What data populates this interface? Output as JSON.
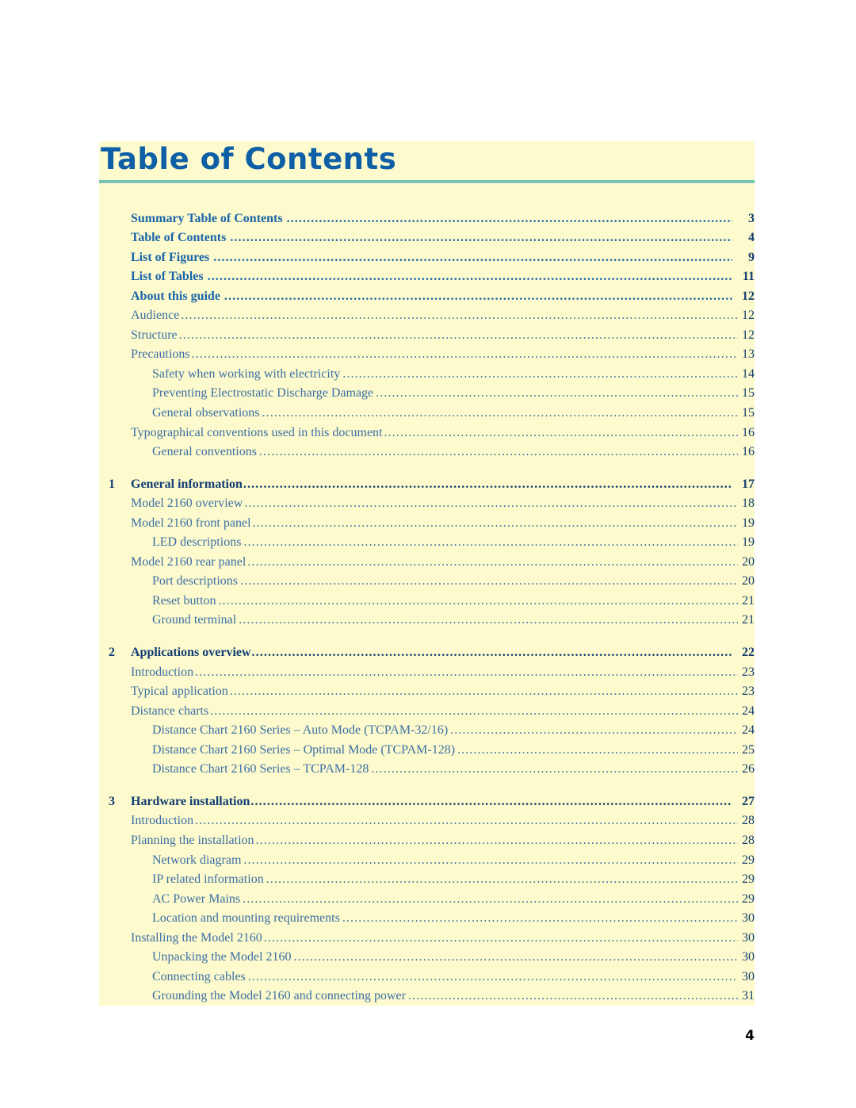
{
  "document": {
    "title": "Table of Contents",
    "footer_page_number": "4",
    "accent_rule_color": "#76c3b4",
    "panel_color": "#fdfbcd",
    "title_color": "#0f5fa6"
  },
  "toc": {
    "entries": [
      {
        "level": "lvl0",
        "number": "",
        "label": "Summary Table of Contents",
        "page": "3"
      },
      {
        "level": "lvl0",
        "number": "",
        "label": "Table of Contents",
        "page": "4"
      },
      {
        "level": "lvl0",
        "number": "",
        "label": "List of Figures",
        "page": "9"
      },
      {
        "level": "lvl0",
        "number": "",
        "label": "List of Tables",
        "page": "11"
      },
      {
        "level": "lvl0",
        "number": "",
        "label": "About this guide",
        "page": "12"
      },
      {
        "level": "lvl1",
        "number": "",
        "label": "Audience",
        "page": "12"
      },
      {
        "level": "lvl1",
        "number": "",
        "label": "Structure",
        "page": "12"
      },
      {
        "level": "lvl1",
        "number": "",
        "label": "Precautions",
        "page": "13"
      },
      {
        "level": "lvl2",
        "number": "",
        "label": "Safety when working with electricity",
        "page": "14"
      },
      {
        "level": "lvl2",
        "number": "",
        "label": "Preventing Electrostatic Discharge Damage",
        "page": "15"
      },
      {
        "level": "lvl2",
        "number": "",
        "label": "General observations",
        "page": "15"
      },
      {
        "level": "lvl1",
        "number": "",
        "label": "Typographical conventions used in this document",
        "page": "16"
      },
      {
        "level": "lvl2",
        "number": "",
        "label": "General conventions",
        "page": "16"
      },
      {
        "level": "chap",
        "number": "1",
        "label": "General information",
        "page": "17",
        "gap": true
      },
      {
        "level": "lvl1",
        "number": "",
        "label": "Model 2160 overview",
        "page": "18"
      },
      {
        "level": "lvl1",
        "number": "",
        "label": "Model 2160 front panel",
        "page": "19"
      },
      {
        "level": "lvl2",
        "number": "",
        "label": "LED descriptions",
        "page": "19"
      },
      {
        "level": "lvl1",
        "number": "",
        "label": "Model 2160 rear panel",
        "page": "20"
      },
      {
        "level": "lvl2",
        "number": "",
        "label": "Port descriptions",
        "page": "20"
      },
      {
        "level": "lvl2",
        "number": "",
        "label": "Reset button",
        "page": "21"
      },
      {
        "level": "lvl2",
        "number": "",
        "label": "Ground terminal",
        "page": "21"
      },
      {
        "level": "chap",
        "number": "2",
        "label": "Applications overview",
        "page": "22",
        "gap": true
      },
      {
        "level": "lvl1",
        "number": "",
        "label": "Introduction",
        "page": "23"
      },
      {
        "level": "lvl1",
        "number": "",
        "label": "Typical application",
        "page": "23"
      },
      {
        "level": "lvl1",
        "number": "",
        "label": "Distance charts",
        "page": "24"
      },
      {
        "level": "lvl2",
        "number": "",
        "label": "Distance Chart 2160 Series – Auto Mode (TCPAM-32/16)",
        "page": "24"
      },
      {
        "level": "lvl2",
        "number": "",
        "label": "Distance Chart 2160 Series – Optimal Mode (TCPAM-128)",
        "page": "25"
      },
      {
        "level": "lvl2",
        "number": "",
        "label": "Distance Chart 2160 Series – TCPAM-128",
        "page": "26"
      },
      {
        "level": "chap",
        "number": "3",
        "label": "Hardware installation",
        "page": "27",
        "gap": true
      },
      {
        "level": "lvl1",
        "number": "",
        "label": "Introduction",
        "page": "28"
      },
      {
        "level": "lvl1",
        "number": "",
        "label": "Planning the installation",
        "page": "28"
      },
      {
        "level": "lvl2",
        "number": "",
        "label": "Network diagram",
        "page": "29"
      },
      {
        "level": "lvl2",
        "number": "",
        "label": "IP related information",
        "page": "29"
      },
      {
        "level": "lvl2",
        "number": "",
        "label": "AC Power Mains",
        "page": "29"
      },
      {
        "level": "lvl2",
        "number": "",
        "label": "Location and mounting requirements",
        "page": "30"
      },
      {
        "level": "lvl1",
        "number": "",
        "label": "Installing the Model 2160",
        "page": "30"
      },
      {
        "level": "lvl2",
        "number": "",
        "label": "Unpacking the Model 2160",
        "page": "30"
      },
      {
        "level": "lvl2",
        "number": "",
        "label": "Connecting cables",
        "page": "30"
      },
      {
        "level": "lvl2",
        "number": "",
        "label": "Grounding the Model 2160 and connecting power",
        "page": "31"
      }
    ]
  }
}
